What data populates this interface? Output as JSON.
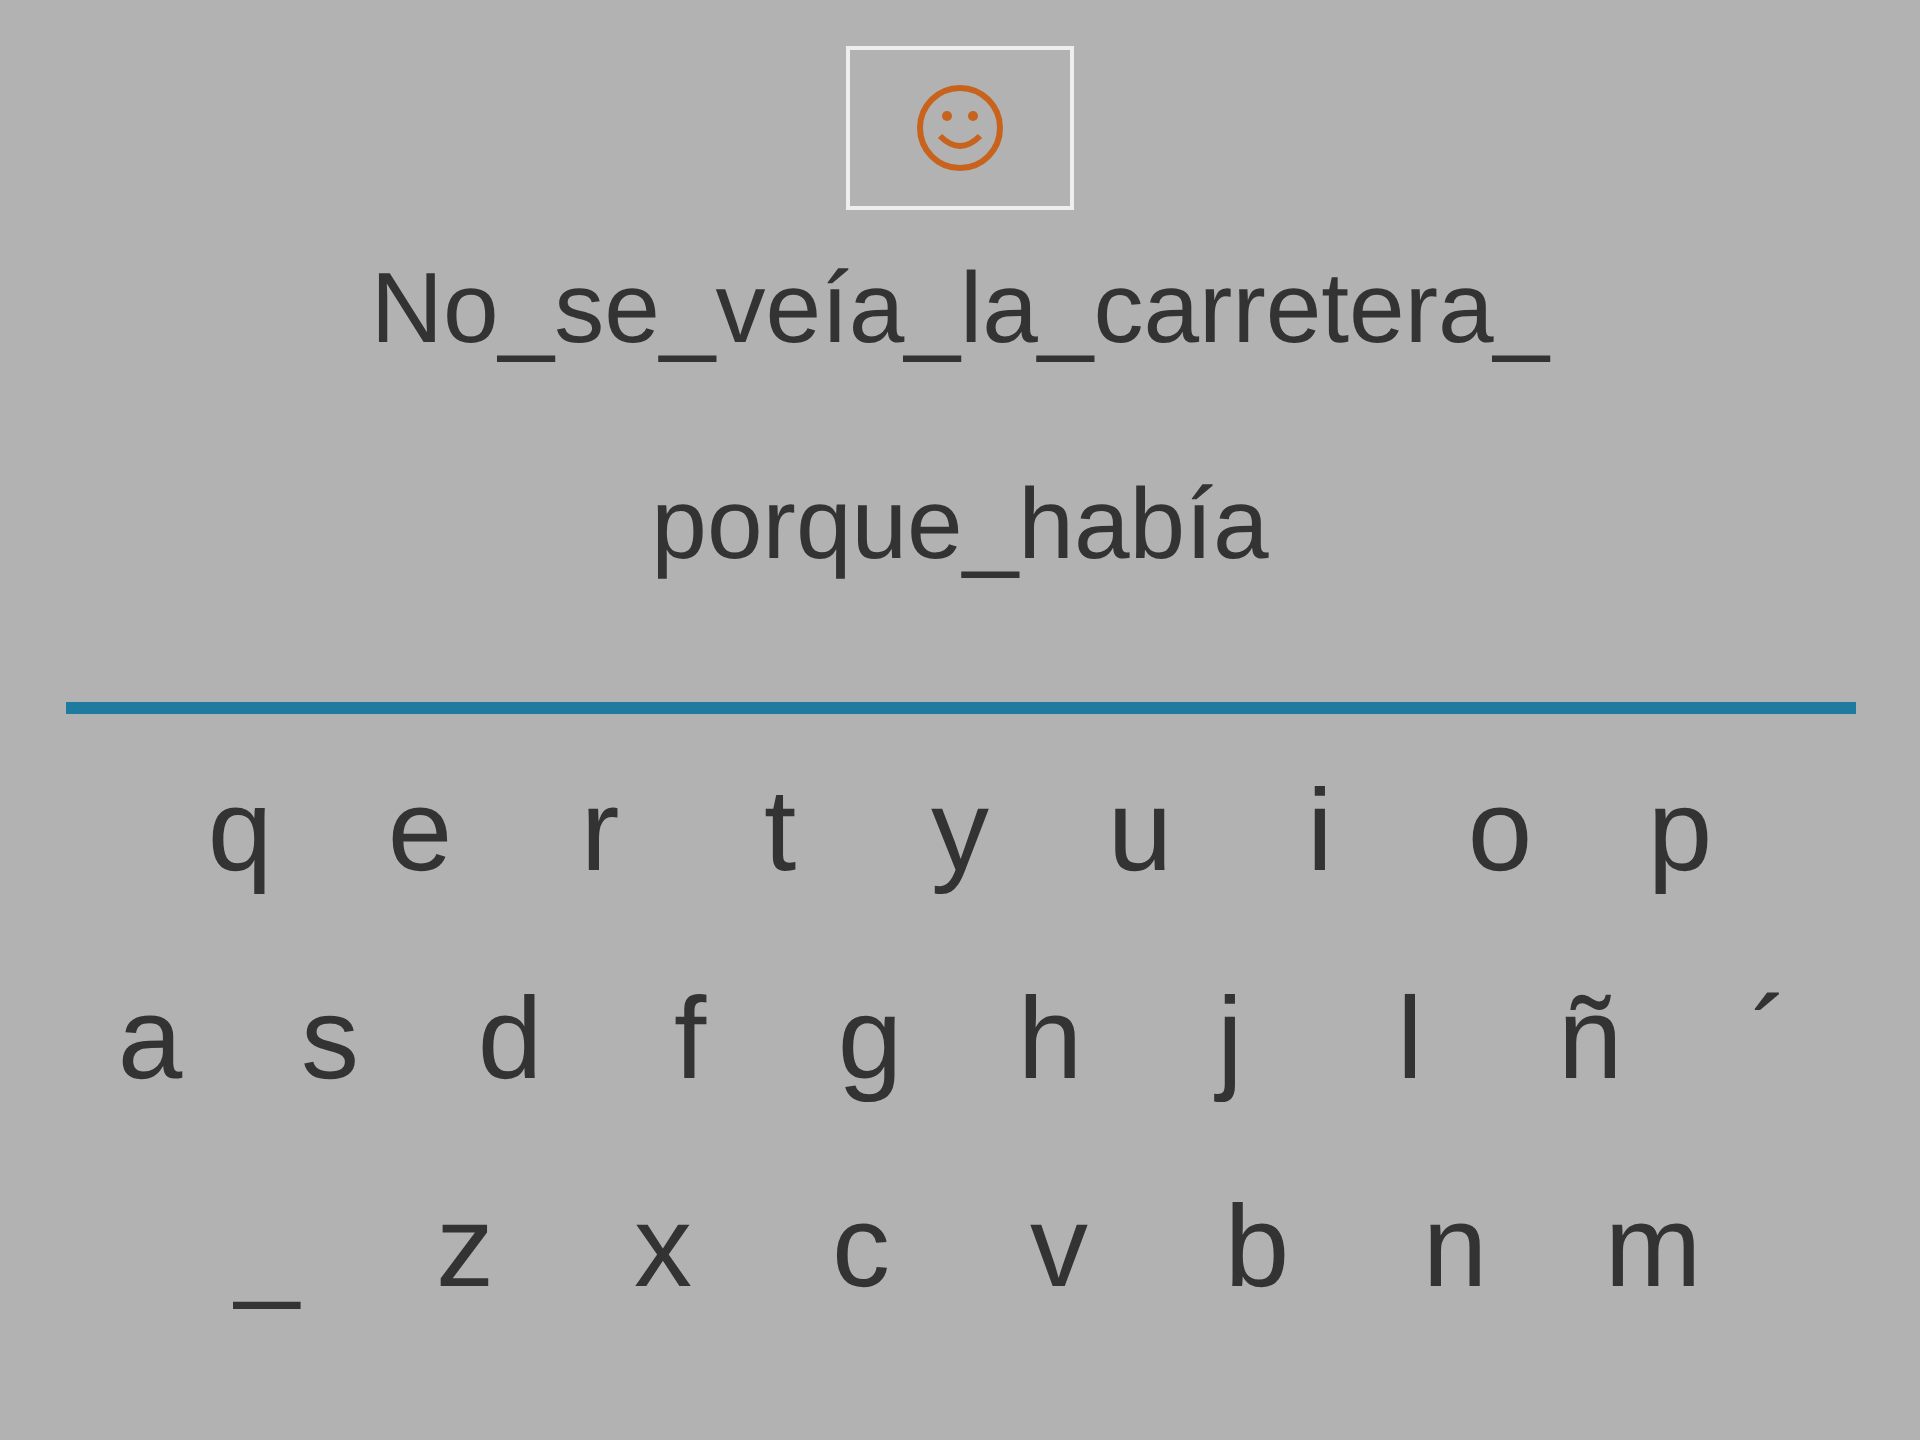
{
  "sentence_lines": [
    "No_se_veía_la_carretera_",
    "porque_había"
  ],
  "keyboard": {
    "rows": [
      [
        "q",
        "e",
        "r",
        "t",
        "y",
        "u",
        "i",
        "o",
        "p"
      ],
      [
        "a",
        "s",
        "d",
        "f",
        "g",
        "h",
        "j",
        "l",
        "ñ",
        "´"
      ],
      [
        "_",
        "z",
        "x",
        "c",
        "v",
        "b",
        "n",
        "m"
      ]
    ]
  }
}
